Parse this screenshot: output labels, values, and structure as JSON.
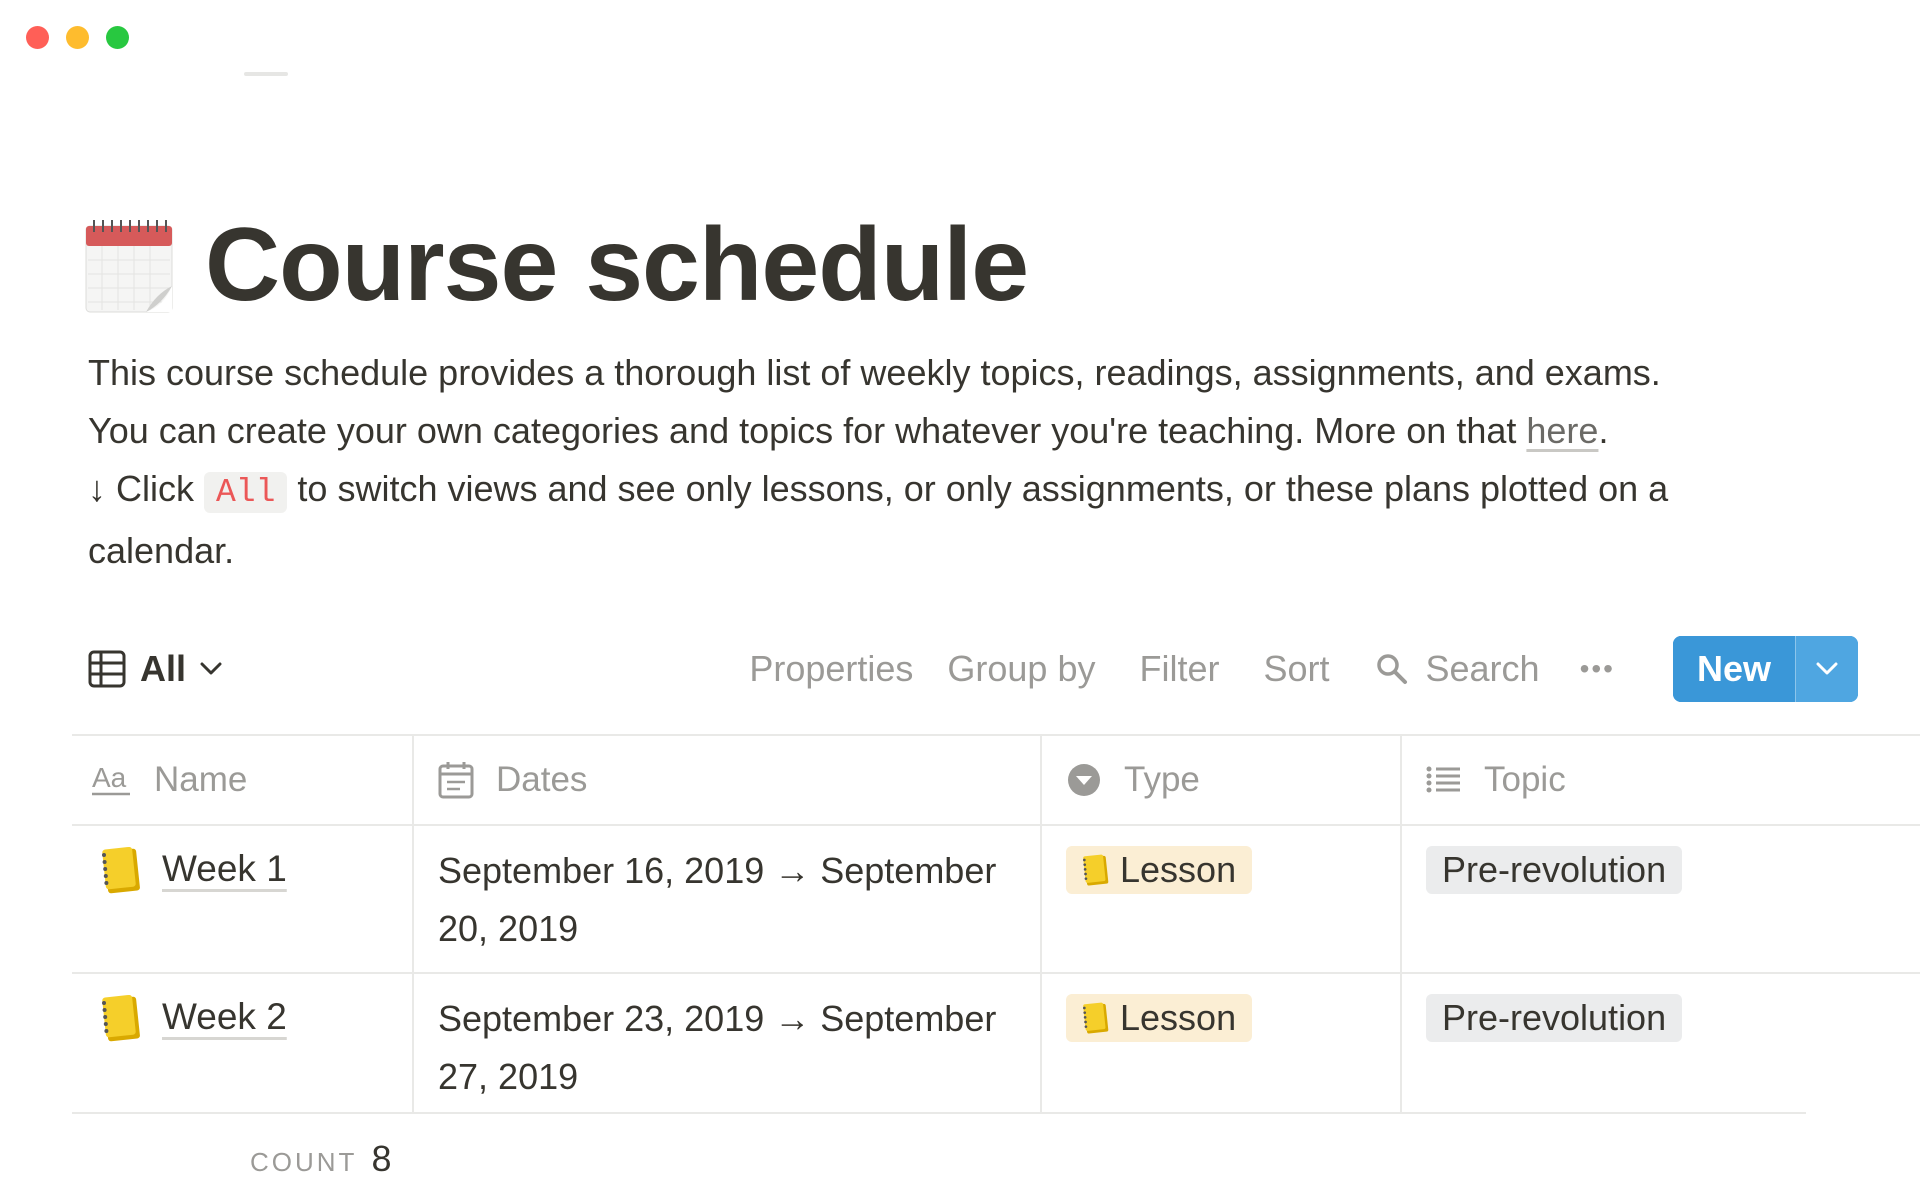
{
  "window": {
    "traffic_lights": [
      "close",
      "minimize",
      "zoom"
    ]
  },
  "page": {
    "icon": "tear-off-calendar-icon",
    "title": "Course schedule",
    "description": {
      "line1": "This course schedule provides a thorough list of weekly topics, readings, assignments, and exams.",
      "line2_before_link": "You can create your own categories and topics for whatever you're teaching. More on that ",
      "line2_link": "here",
      "line2_after_link": ".",
      "line3_before_code": "↓ Click ",
      "line3_code": "All",
      "line3_after_code": " to switch views and see only lessons, or only assignments, or these plans plotted on a calendar."
    }
  },
  "toolbar": {
    "view_icon": "table-icon",
    "view_label": "All",
    "properties": "Properties",
    "group_by": "Group by",
    "filter": "Filter",
    "sort": "Sort",
    "search": "Search",
    "more": "•••",
    "new": "New"
  },
  "table": {
    "columns": [
      {
        "label": "Name",
        "icon": "text-aa-icon"
      },
      {
        "label": "Dates",
        "icon": "calendar-icon"
      },
      {
        "label": "Type",
        "icon": "select-chevron-icon"
      },
      {
        "label": "Topic",
        "icon": "list-icon"
      }
    ],
    "rows": [
      {
        "name": "Week 1",
        "icon": "notebook-icon",
        "dates": "September 16, 2019 → September 20, 2019",
        "type": "Lesson",
        "topic": "Pre-revolution"
      },
      {
        "name": "Week 2",
        "icon": "notebook-icon",
        "dates": "September 23, 2019 → September 27, 2019",
        "type": "Lesson",
        "topic": "Pre-revolution"
      }
    ],
    "count_label": "COUNT",
    "count_value": "8"
  },
  "colors": {
    "text": "#37352f",
    "muted": "#9b9a97",
    "accent_blue": "#3a97d8",
    "lesson_tag": "#fbeed4",
    "topic_tag": "#ebeced",
    "code_red": "#eb5757",
    "divider": "#e9e9e7"
  }
}
